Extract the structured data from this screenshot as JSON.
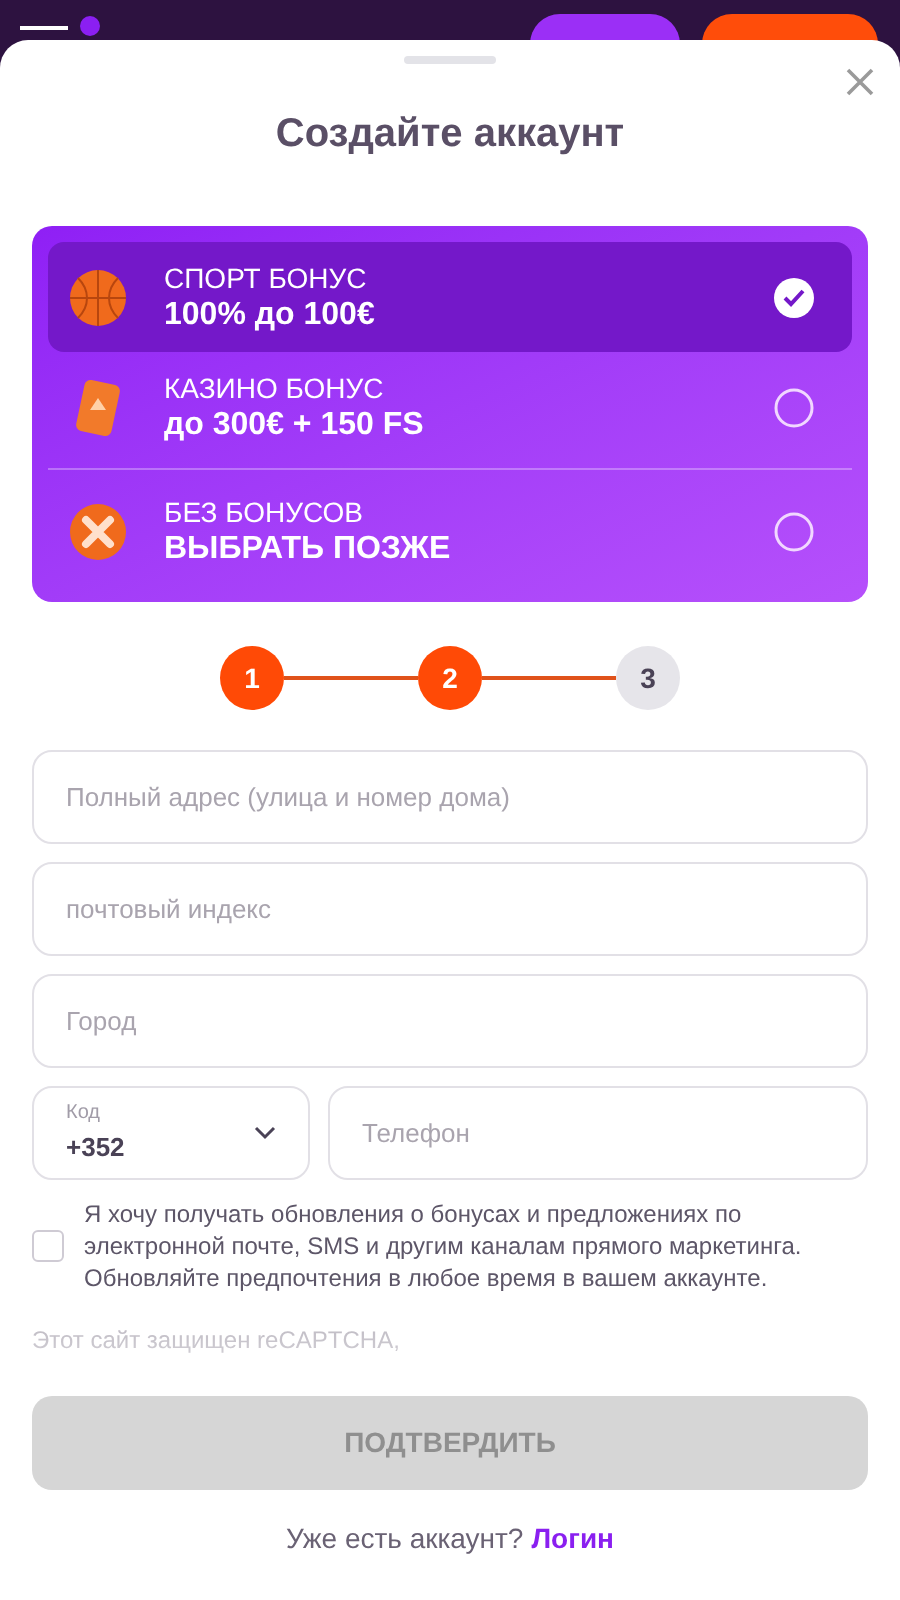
{
  "title": "Создайте аккаунт",
  "bonuses": [
    {
      "kind": "sport",
      "label": "СПОРТ БОНУС",
      "offer": "100% до 100€",
      "selected": true
    },
    {
      "kind": "casino",
      "label": "КАЗИНО БОНУС",
      "offer": "до 300€ + 150 FS",
      "selected": false
    },
    {
      "kind": "none",
      "label": "БЕЗ БОНУСОВ",
      "offer": "ВЫБРАТЬ ПОЗЖЕ",
      "selected": false
    }
  ],
  "steps": [
    {
      "number": "1",
      "completed": true
    },
    {
      "number": "2",
      "completed": true
    },
    {
      "number": "3",
      "completed": false
    }
  ],
  "fields": [
    {
      "placeholder": "Полный адрес (улица и номер дома)"
    },
    {
      "placeholder": "почтовый индекс"
    },
    {
      "placeholder": "Город"
    }
  ],
  "phone": {
    "code_label": "Код",
    "code": "+352",
    "placeholder": "Телефон"
  },
  "marketing": {
    "checked": false,
    "text": "Я хочу получать обновления о бонусах и предложениях по электронной почте, SMS и другим каналам прямого маркетинга. Обновляйте предпочтения в любое время в вашем аккаунте."
  },
  "recaptcha_note": "Этот сайт защищен reCAPTCHA,",
  "submit": {
    "label": "ПОДТВЕРДИТЬ",
    "disabled": true
  },
  "login_prompt": {
    "text": "Уже есть аккаунт?",
    "link": "Логин"
  }
}
